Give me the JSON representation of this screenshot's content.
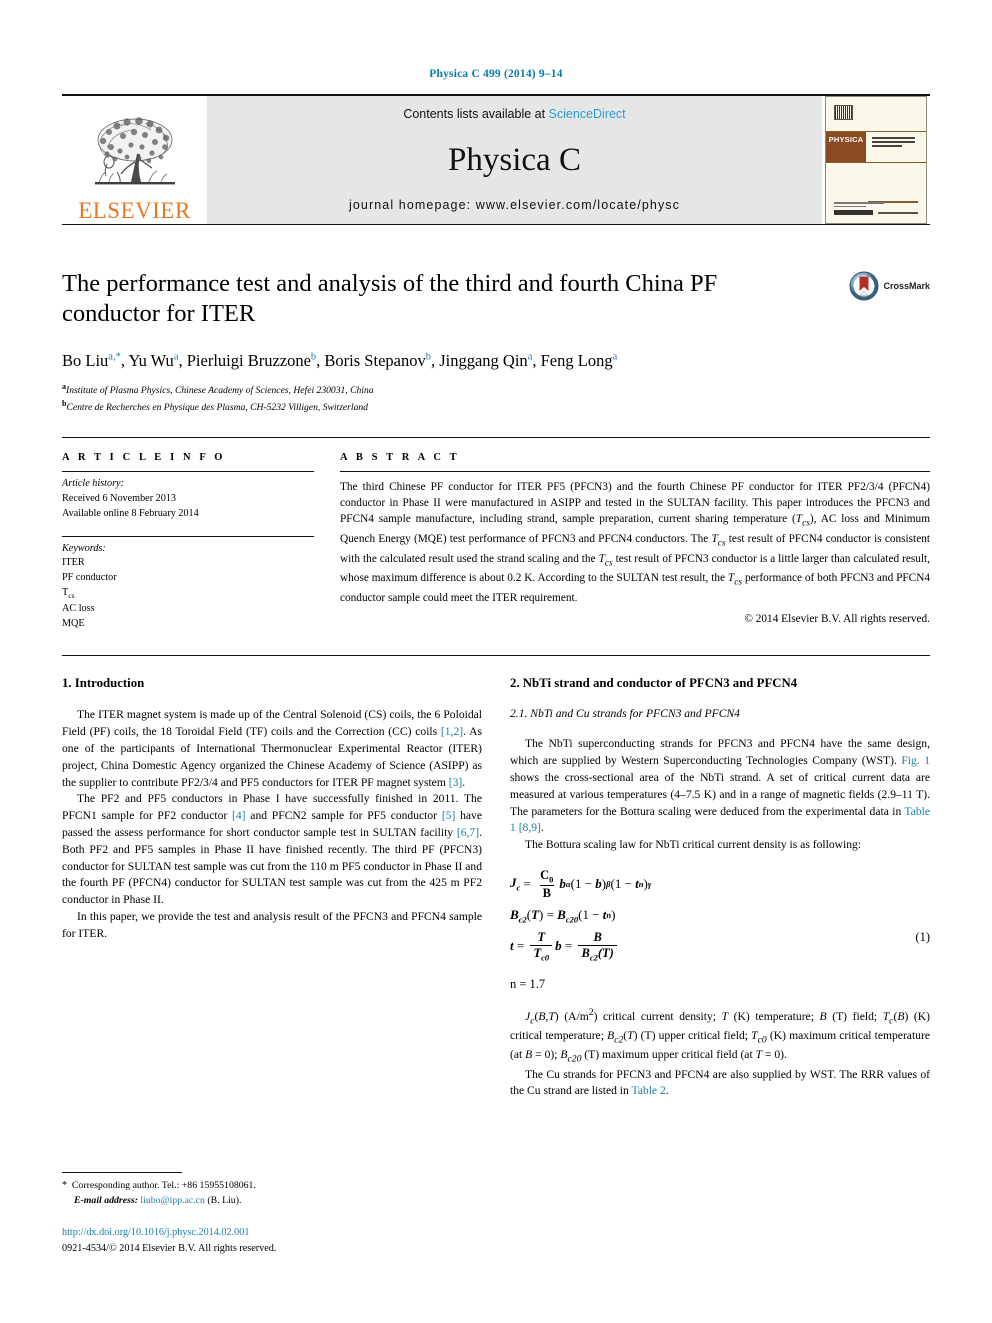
{
  "running_head": "Physica C 499 (2014) 9–14",
  "masthead": {
    "contents_prefix": "Contents lists available at ",
    "contents_link": "ScienceDirect",
    "journal_name": "Physica C",
    "homepage": "journal homepage: www.elsevier.com/locate/physc",
    "publisher_word": "ELSEVIER",
    "cover_brand": "PHYSICA"
  },
  "article": {
    "title": "The performance test and analysis of the third and fourth China PF conductor for ITER",
    "crossmark_label": "CrossMark",
    "authors_html": "Bo Liu<sup>a,*</sup>, Yu Wu<sup>a</sup>, Pierluigi Bruzzone<sup>b</sup>, Boris Stepanov<sup>b</sup>, Jinggang Qin<sup>a</sup>, Feng Long<sup>a</sup>",
    "affiliations": [
      {
        "marker": "a",
        "text": "Institute of Plasma Physics, Chinese Academy of Sciences, Hefei 230031, China"
      },
      {
        "marker": "b",
        "text": "Centre de Recherches en Physique des Plasma, CH-5232 Villigen, Switzerland"
      }
    ]
  },
  "article_info": {
    "heading": "A R T I C L E   I N F O",
    "history_label": "Article history:",
    "history_lines": [
      "Received 6 November 2013",
      "Available online 8 February 2014"
    ],
    "keywords_label": "Keywords:",
    "keywords": [
      "ITER",
      "PF conductor",
      "Tcs",
      "AC loss",
      "MQE"
    ]
  },
  "abstract": {
    "heading": "A B S T R A C T",
    "text_html": "The third Chinese PF conductor for ITER PF5 (PFCN3) and the fourth Chinese PF conductor for ITER PF2/3/4 (PFCN4) conductor in Phase II were manufactured in ASIPP and tested in the SULTAN facility. This paper introduces the PFCN3 and PFCN4 sample manufacture, including strand, sample preparation, current sharing temperature (<i>T<sub>cs</sub></i>), AC loss and Minimum Quench Energy (MQE) test performance of PFCN3 and PFCN4 conductors. The <i>T<sub>cs</sub></i> test result of PFCN4 conductor is consistent with the calculated result used the strand scaling and the <i>T<sub>cs</sub></i> test result of PFCN3 conductor is a little larger than calculated result, whose maximum difference is about 0.2 K. According to the SULTAN test result, the <i>T<sub>cs</sub></i> performance of both PFCN3 and PFCN4 conductor sample could meet the ITER requirement.",
    "copyright": "© 2014 Elsevier B.V. All rights reserved."
  },
  "left_column": {
    "section_title": "1. Introduction",
    "paragraphs_html": [
      "The ITER magnet system is made up of the Central Solenoid (CS) coils, the 6 Poloidal Field (PF) coils, the 18 Toroidal Field (TF) coils and the Correction (CC) coils <span class=\"cite\">[1,2]</span>. As one of the participants of International Thermonuclear Experimental Reactor (ITER) project, China Domestic Agency organized the Chinese Academy of Science (ASIPP) as the supplier to contribute PF2/3/4 and PF5 conductors for ITER PF magnet system <span class=\"cite\">[3]</span>.",
      "The PF2 and PF5 conductors in Phase I have successfully finished in 2011. The PFCN1 sample for PF2 conductor <span class=\"cite\">[4]</span> and PFCN2 sample for PF5 conductor <span class=\"cite\">[5]</span> have passed the assess performance for short conductor sample test in SULTAN facility <span class=\"cite\">[6,7]</span>. Both PF2 and PF5 samples in Phase II have finished recently. The third PF (PFCN3) conductor for SULTAN test sample was cut from the 110 m PF5 conductor in Phase II and the fourth PF (PFCN4) conductor for SULTAN test sample was cut from the 425 m PF2 conductor in Phase II.",
      "In this paper, we provide the test and analysis result of the PFCN3 and PFCN4 sample for ITER."
    ]
  },
  "right_column": {
    "section_title": "2. NbTi strand and conductor of PFCN3 and PFCN4",
    "subsection_title": "2.1. NbTi and Cu strands for PFCN3 and PFCN4",
    "paragraphs_html": [
      "The NbTi superconducting strands for PFCN3 and PFCN4 have the same design, which are supplied by Western Superconducting Technologies Company (WST). <span class=\"cite\">Fig. 1</span> shows the cross-sectional area of the NbTi strand. A set of critical current data are measured at various temperatures (4–7.5 K) and in a range of magnetic fields (2.9–11 T). The parameters for the Bottura scaling were deduced from the experimental data in <span class=\"cite\">Table 1 [8,9]</span>.",
      "The Bottura scaling law for NbTi critical current density is as following:"
    ],
    "equation_number": "(1)",
    "equation_n_line": "n = 1.7",
    "nomenclature_html": "<i>J<sub>c</sub></i>(<i>B</i>,<i>T</i>) (A/m<sup>2</sup>) critical current density; <i>T</i> (K) temperature; <i>B</i> (T) field; <i>T<sub>c</sub></i>(<i>B</i>) (K) critical temperature; <i>B<sub>c2</sub></i>(<i>T</i>) (T) upper critical field; <i>T<sub>c0</sub></i> (K) maximum critical temperature (at <i>B</i> = 0); <i>B<sub>c20</sub></i> (T) maximum upper critical field (at <i>T</i> = 0).",
    "last_paragraph_html": "The Cu strands for PFCN3 and PFCN4 are also supplied by WST. The RRR values of the Cu strand are listed in <span class=\"cite\">Table 2</span>."
  },
  "footer": {
    "corresponding_html": "<span class=\"star\">*</span>&nbsp; Corresponding author. Tel.: +86 15955108061.",
    "email_label": "E-mail address:",
    "email": "liubo@ipp.ac.cn",
    "email_suffix": "(B. Liu).",
    "doi": "http://dx.doi.org/10.1016/j.physc.2014.02.001",
    "issn_line": "0921-4534/© 2014 Elsevier B.V. All rights reserved."
  },
  "colors": {
    "link": "#1a7fa8",
    "elsevier_orange": "#e87722",
    "sciencedirect_blue": "#2a9fd6",
    "masthead_grey": "#e6e6e6"
  }
}
